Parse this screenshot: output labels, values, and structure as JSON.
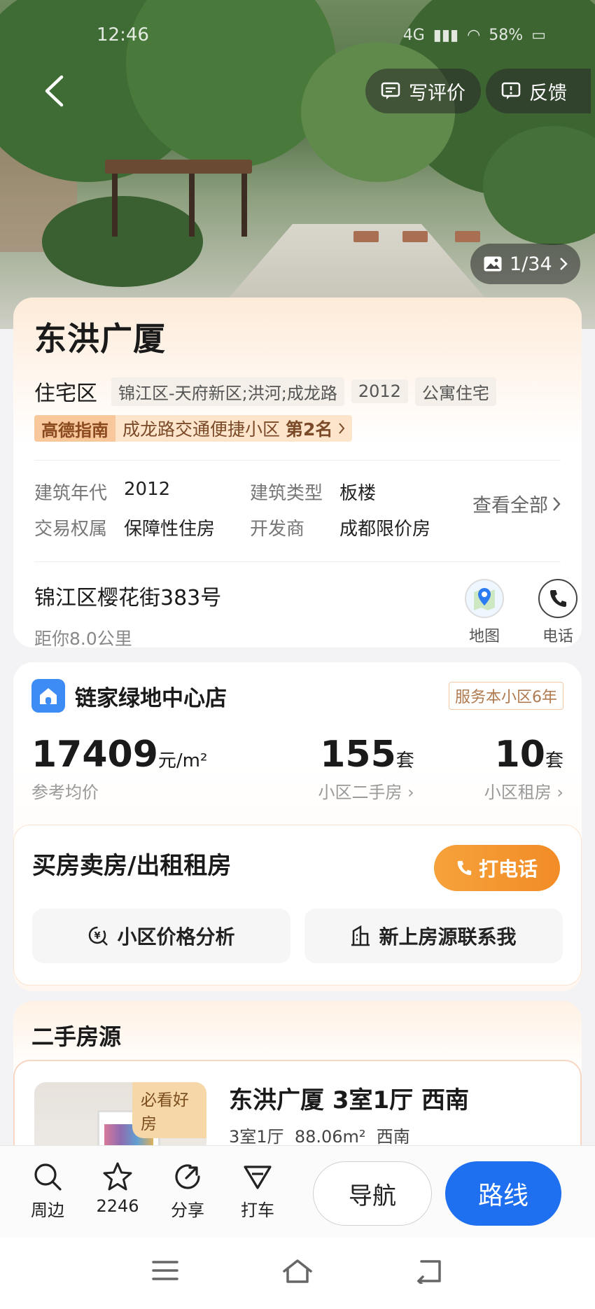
{
  "status_bar": {
    "time": "12:46",
    "network": "4G",
    "battery": "58%"
  },
  "hero": {
    "write_review_label": "写评价",
    "feedback_label": "反馈",
    "photo_counter": "1/34"
  },
  "poi": {
    "name": "东洪广厦",
    "category": "住宅区",
    "tags": [
      "锦江区-天府新区;洪河;成龙路",
      "2012",
      "公寓住宅"
    ],
    "rank_source": "高德指南",
    "rank_text": "成龙路交通便捷小区",
    "rank_value": "第2名",
    "specs": [
      {
        "key": "建筑年代",
        "value": "2012"
      },
      {
        "key": "建筑类型",
        "value": "板楼"
      },
      {
        "key": "交易权属",
        "value": "保障性住房"
      },
      {
        "key": "开发商",
        "value": "成都限价房"
      }
    ],
    "view_all_label": "查看全部",
    "address": "锦江区樱花街383号",
    "distance": "距你8.0公里",
    "map_label": "地图",
    "phone_label": "电话"
  },
  "agency": {
    "name": "链家绿地中心店",
    "service_badge": "服务本小区6年",
    "avg_price": "17409",
    "avg_price_unit": "元/m²",
    "avg_price_label": "参考均价",
    "secondhand_count": "155",
    "secondhand_unit": "套",
    "secondhand_label": "小区二手房",
    "rental_count": "10",
    "rental_unit": "套",
    "rental_label": "小区租房",
    "contact_title": "买房卖房/出租租房",
    "call_label": "打电话",
    "price_analysis_label": "小区价格分析",
    "new_listing_label": "新上房源联系我"
  },
  "listings": {
    "section_title": "二手房源",
    "items": [
      {
        "badge": "必看好房",
        "title": "东洪广厦 3室1厅 西南",
        "rooms": "3室1厅",
        "area": "88.06m²",
        "orientation": "西南"
      }
    ]
  },
  "action_bar": {
    "nearby_label": "周边",
    "favorite_count": "2246",
    "share_label": "分享",
    "taxi_label": "打车",
    "navigate_label": "导航",
    "route_label": "路线"
  }
}
